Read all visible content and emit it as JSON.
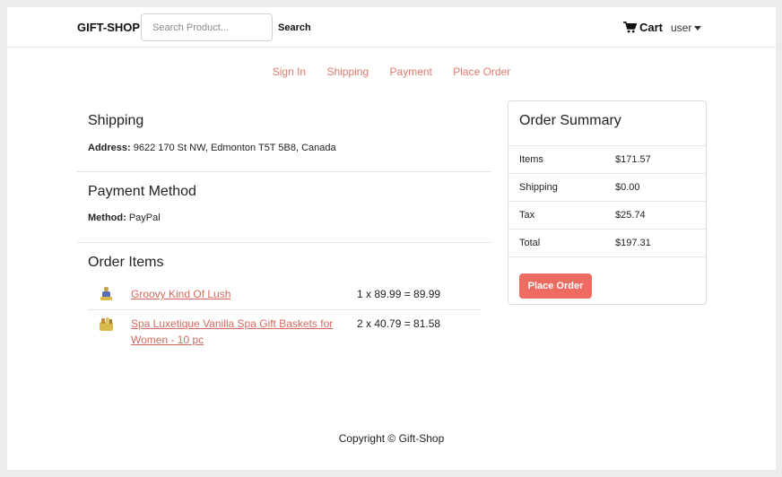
{
  "navbar": {
    "brand": "GIFT-SHOP",
    "search_placeholder": "Search Product...",
    "search_label": "Search",
    "cart_label": "Cart",
    "user_label": "user"
  },
  "steps": [
    "Sign In",
    "Shipping",
    "Payment",
    "Place Order"
  ],
  "shipping": {
    "title": "Shipping",
    "address_label": "Address:",
    "address_value": "9622 170 St NW, Edmonton T5T 5B8, Canada"
  },
  "payment": {
    "title": "Payment Method",
    "method_label": "Method:",
    "method_value": "PayPal"
  },
  "order_items": {
    "title": "Order Items",
    "items": [
      {
        "name": "Groovy Kind Of Lush",
        "price_line": "1 x 89.99 = 89.99"
      },
      {
        "name": "Spa Luxetique Vanilla Spa Gift Baskets for Women - 10 pc",
        "price_line": "2 x 40.79 = 81.58"
      }
    ]
  },
  "summary": {
    "title": "Order Summary",
    "rows": [
      {
        "label": "Items",
        "value": "$171.57"
      },
      {
        "label": "Shipping",
        "value": "$0.00"
      },
      {
        "label": "Tax",
        "value": "$25.74"
      },
      {
        "label": "Total",
        "value": "$197.31"
      }
    ],
    "button_label": "Place Order"
  },
  "footer": "Copyright © Gift-Shop",
  "colors": {
    "accent": "#ef6b61",
    "link": "#d66a5e"
  }
}
